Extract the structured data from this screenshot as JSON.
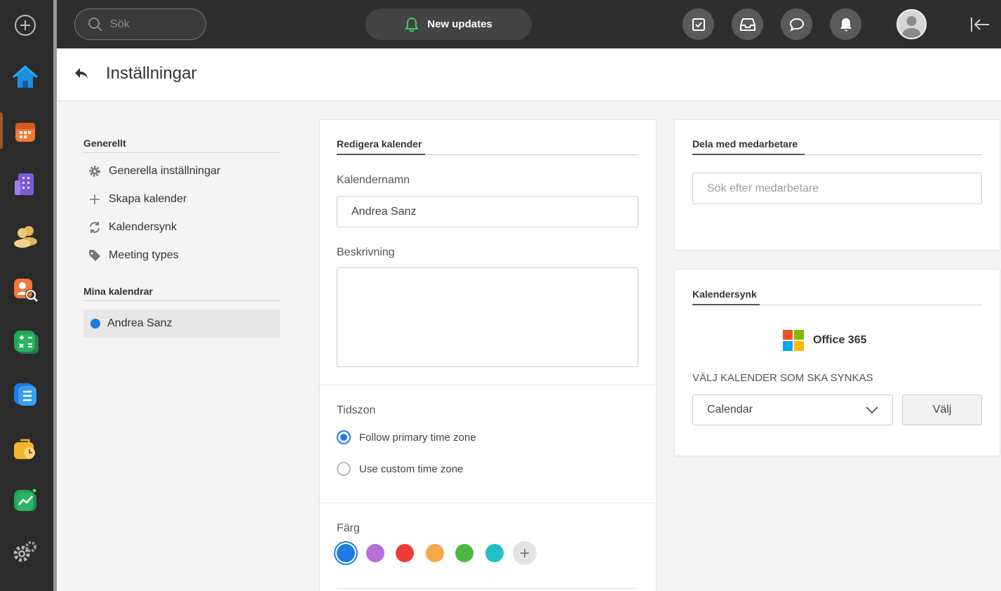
{
  "topbar": {
    "search_placeholder": "Sök",
    "updates_label": "New updates"
  },
  "header": {
    "title": "Inställningar"
  },
  "nav": {
    "general_heading": "Generellt",
    "general_items": [
      {
        "label": "Generella inställningar",
        "icon": "gear-icon"
      },
      {
        "label": "Skapa kalender",
        "icon": "plus-icon"
      },
      {
        "label": "Kalendersynk",
        "icon": "sync-icon"
      },
      {
        "label": "Meeting types",
        "icon": "tag-icon"
      }
    ],
    "calendars_heading": "Mina kalendrar",
    "calendars": [
      {
        "label": "Andrea Sanz",
        "color": "#1e7ce2"
      }
    ]
  },
  "edit": {
    "title": "Redigera kalender",
    "name_label": "Kalendernamn",
    "name_value": "Andrea Sanz",
    "desc_label": "Beskrivning",
    "desc_value": "",
    "tz_label": "Tidszon",
    "tz_options": [
      {
        "label": "Follow primary time zone",
        "selected": true
      },
      {
        "label": "Use custom time zone",
        "selected": false
      }
    ],
    "color_label": "Färg",
    "colors": [
      "#1e7ce2",
      "#b56fd6",
      "#ef3b3b",
      "#f5a94a",
      "#4cb842",
      "#20c0c6"
    ],
    "selected_color": "#1e7ce2"
  },
  "share": {
    "title": "Dela med medarbetare",
    "search_placeholder": "Sök efter medarbetare"
  },
  "sync": {
    "title": "Kalendersynk",
    "provider": "Office 365",
    "choose_label": "VÄLJ KALENDER SOM SKA SYNKAS",
    "selected_calendar": "Calendar",
    "choose_button": "Välj"
  }
}
